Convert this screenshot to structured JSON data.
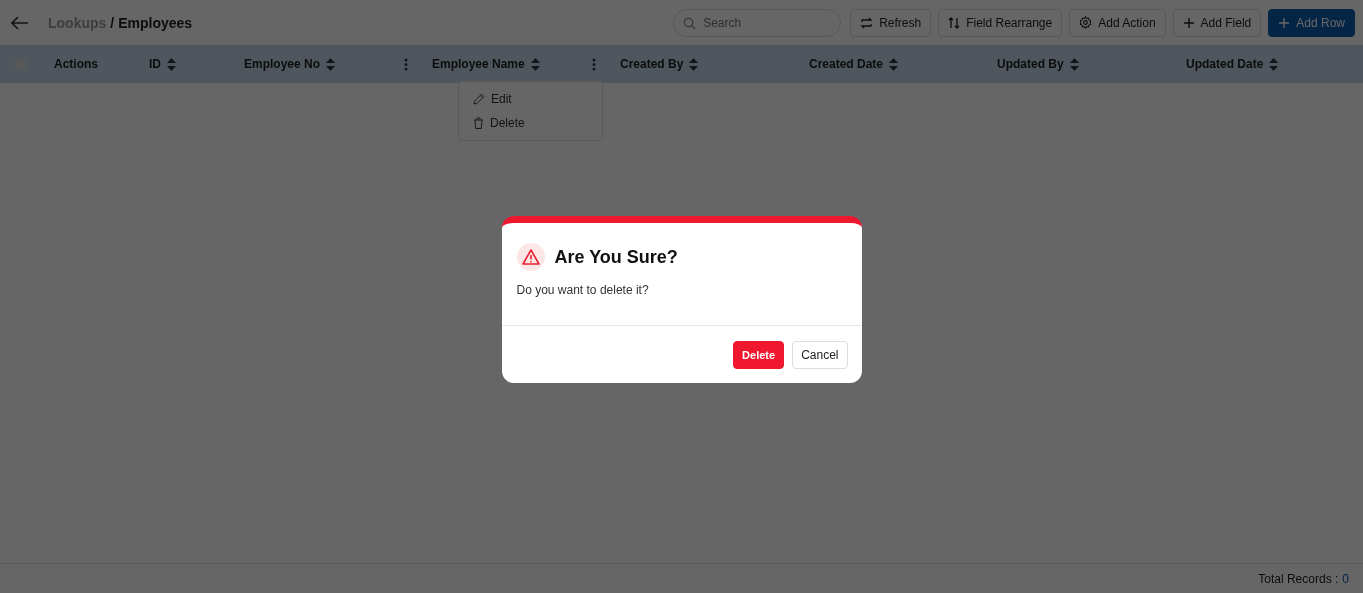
{
  "breadcrumb": {
    "parent": "Lookups",
    "separator": "/",
    "current": "Employees"
  },
  "search": {
    "placeholder": "Search"
  },
  "toolbar": [
    {
      "label": "Refresh",
      "kind": "outline"
    },
    {
      "label": "Field Rearrange",
      "kind": "outline"
    },
    {
      "label": "Add Action",
      "kind": "outline"
    },
    {
      "label": "Add Field",
      "kind": "outline"
    },
    {
      "label": "Add Row",
      "kind": "primary"
    }
  ],
  "table": {
    "select_all": {
      "checked": false
    },
    "columns": [
      {
        "label": "Actions",
        "sortable": false,
        "menu": false
      },
      {
        "label": "ID",
        "sortable": true,
        "menu": false
      },
      {
        "label": "Employee No",
        "sortable": true,
        "menu": true
      },
      {
        "label": "Employee Name",
        "sortable": true,
        "menu": true,
        "menu_open": true
      },
      {
        "label": "Created By",
        "sortable": true,
        "menu": false
      },
      {
        "label": "Created Date",
        "sortable": true,
        "menu": false
      },
      {
        "label": "Updated By",
        "sortable": true,
        "menu": false
      },
      {
        "label": "Updated Date",
        "sortable": true,
        "menu": false
      }
    ]
  },
  "column_menu": [
    {
      "label": "Edit"
    },
    {
      "label": "Delete"
    }
  ],
  "dialog": {
    "title": "Are You Sure?",
    "message": "Do you want to delete it?",
    "buttons": [
      {
        "label": "Delete",
        "kind": "danger"
      },
      {
        "label": "Cancel",
        "kind": "plain"
      }
    ]
  },
  "footer": {
    "label": "Total Records :",
    "count": "0"
  }
}
